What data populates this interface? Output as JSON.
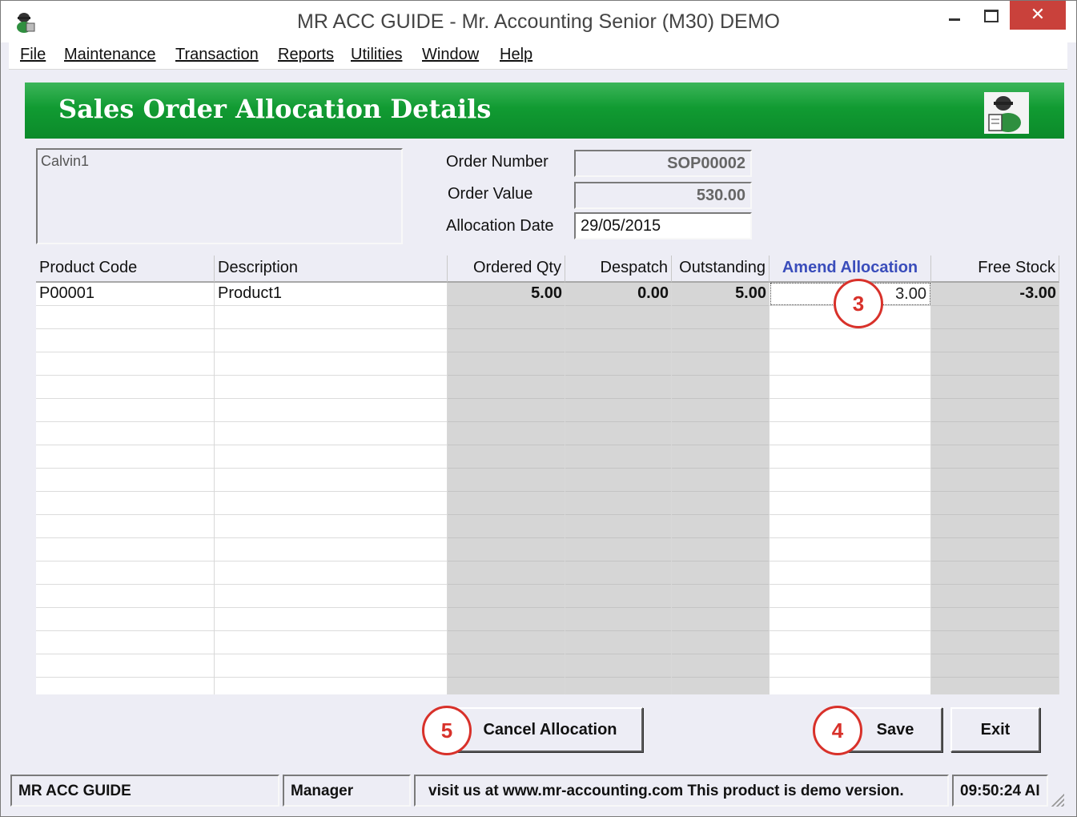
{
  "window": {
    "title": "MR ACC GUIDE - Mr. Accounting Senior (M30) DEMO",
    "close_glyph": "✕"
  },
  "menu": [
    "File",
    "Maintenance",
    "Transaction",
    "Reports",
    "Utilities",
    "Window",
    "Help"
  ],
  "form": {
    "title": "Sales Order Allocation Details",
    "customer_name": "Calvin1",
    "order_number_label": "Order Number",
    "order_number": "SOP00002",
    "order_value_label": "Order Value",
    "order_value": "530.00",
    "allocation_date_label": "Allocation Date",
    "allocation_date": "29/05/2015"
  },
  "grid": {
    "columns": [
      "Product Code",
      "Description",
      "Ordered Qty",
      "Despatch",
      "Outstanding",
      "Amend Allocation",
      "Free Stock"
    ],
    "rows": [
      {
        "product_code": "P00001",
        "description": "Product1",
        "ordered_qty": "5.00",
        "despatch": "0.00",
        "outstanding": "5.00",
        "amend_allocation": "3.00",
        "free_stock": "-3.00"
      }
    ]
  },
  "buttons": {
    "cancel_allocation": "Cancel Allocation",
    "save": "Save",
    "exit": "Exit"
  },
  "callouts": [
    "3",
    "4",
    "5"
  ],
  "status": {
    "app": "MR ACC GUIDE",
    "user": "Manager",
    "message": "visit us at www.mr-accounting.com This product is demo version.",
    "time": "09:50:24 AI"
  },
  "colors": {
    "banner_green": "#119b32",
    "amend_header_blue": "#3a4dbb",
    "callout_red": "#d8312a",
    "close_button_red": "#c9413b"
  }
}
